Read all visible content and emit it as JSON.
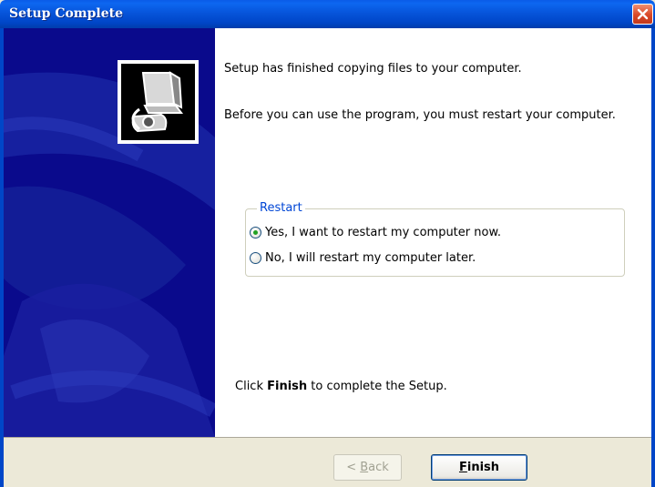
{
  "window": {
    "title": "Setup Complete"
  },
  "body": {
    "line1": "Setup has finished copying files to your computer.",
    "line2": "Before you can use the program, you must restart your computer.",
    "finish_prefix": "Click ",
    "finish_bold": "Finish",
    "finish_suffix": " to complete the Setup."
  },
  "restart_group": {
    "title": "Restart",
    "options": [
      {
        "label": "Yes, I want to restart my computer now.",
        "checked": true
      },
      {
        "label": "No, I will restart my computer later.",
        "checked": false
      }
    ]
  },
  "buttons": {
    "back_prefix": "< ",
    "back_mnemonic": "B",
    "back_rest": "ack",
    "finish_mnemonic": "F",
    "finish_rest": "inish"
  },
  "colors": {
    "titlebar": "#0046c8",
    "panel": "#0a0a8c",
    "group_title": "#0046d5"
  },
  "icons": {
    "close": "close-icon",
    "setup": "computer-setup-icon"
  }
}
